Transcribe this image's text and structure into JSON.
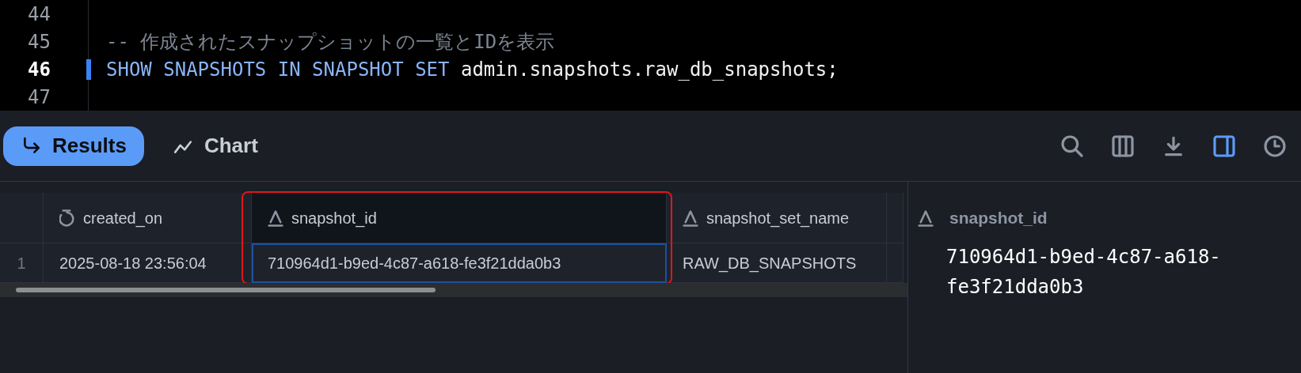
{
  "editor": {
    "lines": [
      {
        "number": "44",
        "active": false
      },
      {
        "number": "45",
        "active": false,
        "tokens": [
          {
            "kind": "comment",
            "text": "-- 作成されたスナップショットの一覧とIDを表示"
          }
        ]
      },
      {
        "number": "46",
        "active": true,
        "tokens": [
          {
            "kind": "keyword",
            "text": "SHOW SNAPSHOTS IN SNAPSHOT SET"
          },
          {
            "kind": "plain",
            "text": " admin.snapshots.raw_db_snapshots;"
          }
        ]
      },
      {
        "number": "47",
        "active": false
      }
    ]
  },
  "tabs": [
    {
      "label": "Results",
      "selected": true
    },
    {
      "label": "Chart",
      "selected": false
    }
  ],
  "tools": [
    {
      "selected": false
    },
    {
      "selected": false
    },
    {
      "selected": false
    },
    {
      "selected": true
    },
    {
      "selected": false
    }
  ],
  "table": {
    "columns": [
      {
        "label": "created_on",
        "kind": "time",
        "selected": false
      },
      {
        "label": "snapshot_id",
        "kind": "text",
        "selected": true
      },
      {
        "label": "snapshot_set_name",
        "kind": "text",
        "selected": false
      }
    ],
    "rows": [
      {
        "number": "1",
        "cells": [
          "2025-08-18 23:56:04",
          "710964d1-b9ed-4c87-a618-fe3f21dda0b3",
          "RAW_DB_SNAPSHOTS"
        ]
      }
    ]
  },
  "detail": {
    "label": "snapshot_id",
    "value": "710964d1-b9ed-4c87-a618-fe3f21dda0b3"
  }
}
